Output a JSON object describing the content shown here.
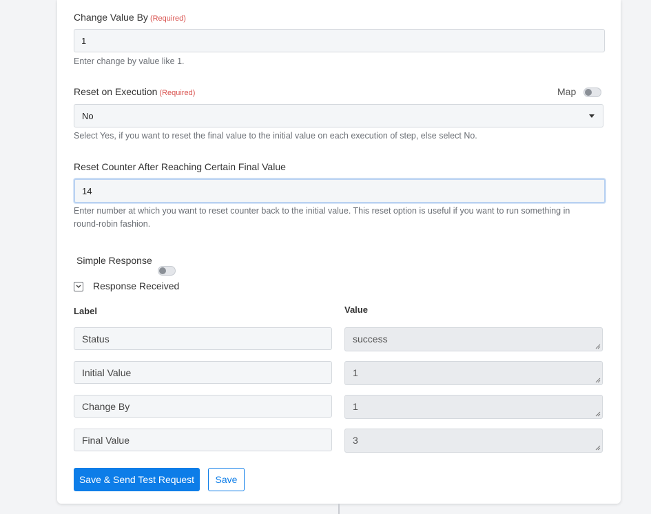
{
  "change_value": {
    "label": "Change Value By",
    "required": "(Required)",
    "value": "1",
    "help": "Enter change by value like 1."
  },
  "reset_exec": {
    "label": "Reset on Execution",
    "required": "(Required)",
    "map_label": "Map",
    "selected": "No",
    "help": "Select Yes, if you want to reset the final value to the initial value on each execution of step, else select No."
  },
  "reset_counter": {
    "label": "Reset Counter After Reaching Certain Final Value",
    "value": "14",
    "help_line1": "Enter number at which you want to reset counter back to the initial value. This reset option is useful if you want to run something in",
    "help_line2": "round-robin fashion."
  },
  "simple_response": {
    "label": "Simple Response"
  },
  "response_received": {
    "label": "Response Received"
  },
  "table": {
    "label_header": "Label",
    "value_header": "Value",
    "rows": [
      {
        "label": "Status",
        "value": "success"
      },
      {
        "label": "Initial Value",
        "value": "1"
      },
      {
        "label": "Change By",
        "value": "1"
      },
      {
        "label": "Final Value",
        "value": "3"
      }
    ]
  },
  "buttons": {
    "save_send": "Save & Send Test Request",
    "save": "Save"
  },
  "colors": {
    "accent": "#0d7de8",
    "required": "#d9534f",
    "focus_border": "#b9d2f2"
  }
}
